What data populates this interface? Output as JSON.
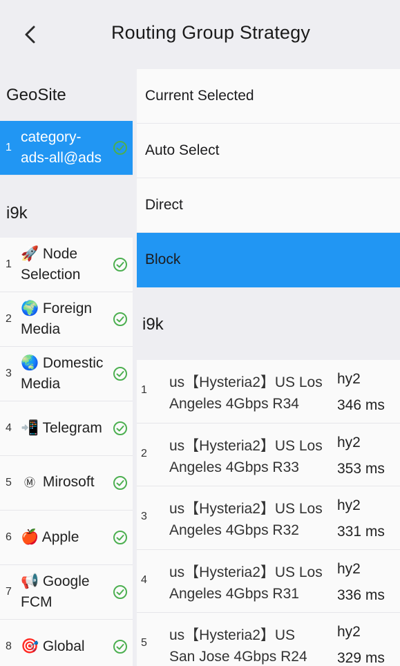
{
  "header": {
    "title": "Routing Group Strategy"
  },
  "left": {
    "geosite_title": "GeoSite",
    "geosite_items": [
      {
        "index": "1",
        "label": "category-ads-all@ads"
      }
    ],
    "i9k_title": "i9k",
    "i9k_items": [
      {
        "index": "1",
        "emoji": "🚀",
        "label": "Node Selection"
      },
      {
        "index": "2",
        "emoji": "🌍",
        "label": "Foreign Media"
      },
      {
        "index": "3",
        "emoji": "🌏",
        "label": "Domestic Media"
      },
      {
        "index": "4",
        "emoji": "📲",
        "label": "Telegram"
      },
      {
        "index": "5",
        "emoji": "Ⓜ",
        "label": "Mirosoft"
      },
      {
        "index": "6",
        "emoji": "🍎",
        "label": "Apple"
      },
      {
        "index": "7",
        "emoji": "📢",
        "label": "Google FCM"
      },
      {
        "index": "8",
        "emoji": "🎯",
        "label": "Global"
      }
    ]
  },
  "right": {
    "options": [
      {
        "label": "Current Selected"
      },
      {
        "label": "Auto Select"
      },
      {
        "label": "Direct"
      },
      {
        "label": "Block"
      }
    ],
    "selected_option": "Block",
    "nodes_title": "i9k",
    "nodes": [
      {
        "index": "1",
        "name": "us【Hysteria2】US Los Angeles  4Gbps R34",
        "protocol": "hy2",
        "latency": "346 ms"
      },
      {
        "index": "2",
        "name": "us【Hysteria2】US Los Angeles  4Gbps R33",
        "protocol": "hy2",
        "latency": "353 ms"
      },
      {
        "index": "3",
        "name": "us【Hysteria2】US Los Angeles  4Gbps R32",
        "protocol": "hy2",
        "latency": "331 ms"
      },
      {
        "index": "4",
        "name": "us【Hysteria2】US Los Angeles  4Gbps R31",
        "protocol": "hy2",
        "latency": "336 ms"
      },
      {
        "index": "5",
        "name": "us【Hysteria2】US San Jose  4Gbps R24",
        "protocol": "hy2",
        "latency": "329 ms"
      }
    ]
  },
  "colors": {
    "accent": "#2196f3",
    "check": "#4caf50",
    "background": "#eeeef2",
    "row": "#fafafa"
  },
  "icons": {
    "back": "chevron-left-icon",
    "check": "check-circle-icon"
  }
}
